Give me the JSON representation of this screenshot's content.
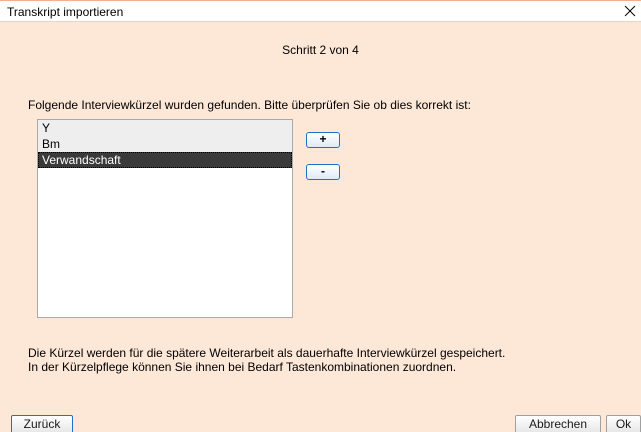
{
  "window": {
    "title": "Transkript importieren",
    "close_icon": "close-icon"
  },
  "step": "Schritt 2 von 4",
  "instruction": "Folgende Interviewkürzel wurden gefunden. Bitte überprüfen Sie ob dies korrekt ist:",
  "list": {
    "items": [
      {
        "label": "Y",
        "selected": false
      },
      {
        "label": "Bm",
        "selected": false
      },
      {
        "label": "Verwandschaft",
        "selected": true
      }
    ]
  },
  "side_buttons": {
    "add_label": "+",
    "remove_label": "-"
  },
  "info": {
    "line1": "Die Kürzel werden für die spätere Weiterarbeit als dauerhafte Interviewkürzel gespeichert.",
    "line2": "In der Kürzelpflege können Sie ihnen bei Bedarf Tastenkombinationen zuordnen."
  },
  "footer": {
    "back_label": "Zurück",
    "cancel_label": "Abbrechen",
    "ok_label": "Ok"
  },
  "colors": {
    "dialog_background": "#fde8d8",
    "button_border_accent": "#1b75c4",
    "selected_row": "#3a3a3a"
  }
}
